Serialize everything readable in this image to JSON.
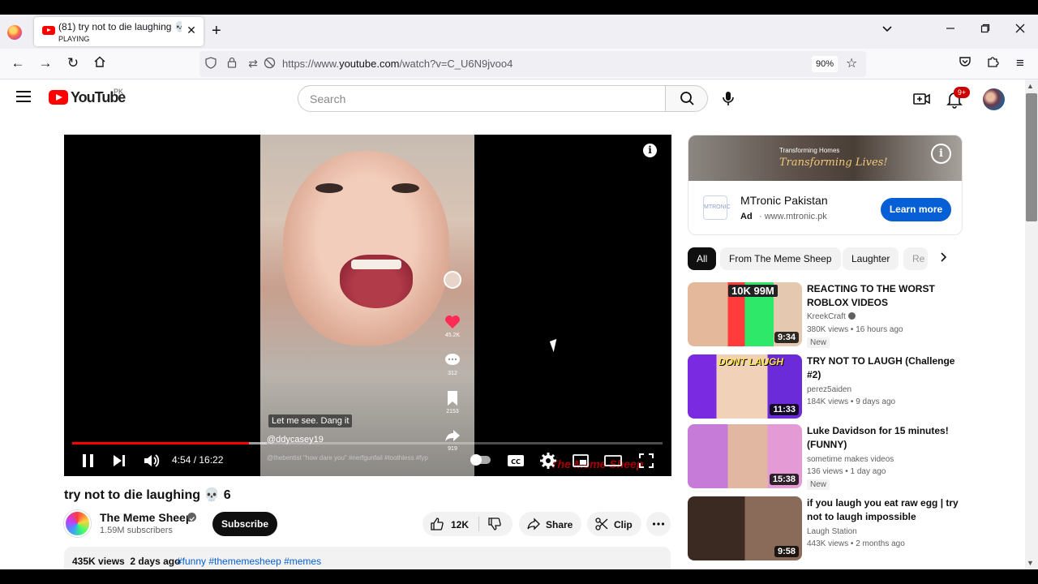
{
  "browser": {
    "tab_title": "(81) try not to die laughing 💀 6",
    "tab_subtitle": "PLAYING",
    "url_prefix": "https://www.",
    "url_host": "youtube.com",
    "url_path": "/watch?v=C_U6N9jvoo4",
    "zoom": "90%"
  },
  "masthead": {
    "logo_text": "YouTube",
    "country": "PK",
    "search_placeholder": "Search",
    "notification_count": "9+"
  },
  "player": {
    "overlay_caption": "Let me see. Dang it",
    "overlay_user": "@ddycasey19",
    "overlay_desc": "@thebentist \"how dare you\" #nerfgunfail #toothless #fyp",
    "side_counts": [
      "45.2K",
      "312",
      "2153",
      "919"
    ],
    "watermark": "The Meme Sheep",
    "time": "4:54 / 16:22",
    "progress_fraction": 0.299,
    "buffer_fraction": 0.33
  },
  "video": {
    "title": "try not to die laughing 💀 6",
    "channel": "The Meme Sheep",
    "subscribers": "1.59M subscribers",
    "subscribe_label": "Subscribe",
    "likes": "12K",
    "share_label": "Share",
    "clip_label": "Clip",
    "views": "435K views",
    "age": "2 days ago",
    "tags": "#funny #thememesheep #memes"
  },
  "ad": {
    "banner_line1": "Transforming Homes",
    "banner_line2": "Transforming Lives!",
    "logo_text": "MTRONIC",
    "name": "MTronic Pakistan",
    "badge": "Ad",
    "url": "www.mtronic.pk",
    "cta": "Learn more"
  },
  "chips": [
    "All",
    "From The Meme Sheep",
    "Laughter",
    "Re"
  ],
  "recommendations": [
    {
      "title": "REACTING TO THE WORST ROBLOX VIDEOS",
      "channel": "KreekCraft",
      "meta": "380K views • 16 hours ago",
      "badge": "New",
      "duration": "9:34",
      "thumb_text": "10K 99M"
    },
    {
      "title": "TRY NOT TO LAUGH (Challenge #2)",
      "channel": "perez5aiden",
      "meta": "184K views • 9 days ago",
      "duration": "11:33",
      "thumb_text": "DONT LAUGH"
    },
    {
      "title": "Luke Davidson for 15 minutes! (FUNNY)",
      "channel": "sometime makes videos",
      "meta": "136 views • 1 day ago",
      "badge": "New",
      "duration": "15:38"
    },
    {
      "title": "if you laugh you eat raw egg | try not to laugh impossible",
      "channel": "Laugh Station",
      "meta": "443K views • 2 months ago",
      "duration": "9:58"
    }
  ]
}
